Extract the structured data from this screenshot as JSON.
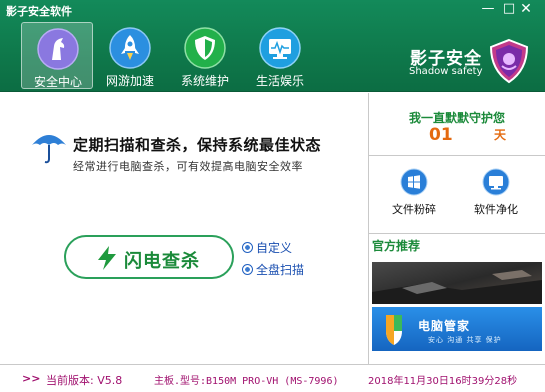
{
  "window": {
    "title": "影子安全软件",
    "min_glyph": "—",
    "max_glyph": "□",
    "close_glyph": "✕"
  },
  "nav": {
    "tabs": [
      {
        "label": "安全中心",
        "icon": "shield-horse-icon",
        "active": true
      },
      {
        "label": "网游加速",
        "icon": "rocket-icon",
        "active": false
      },
      {
        "label": "系统维护",
        "icon": "shield-icon",
        "active": false
      },
      {
        "label": "生活娱乐",
        "icon": "monitor-icon",
        "active": false
      }
    ]
  },
  "brand": {
    "name": "影子安全",
    "name_en": "Shadow safety",
    "logo": "shadow-shield-logo"
  },
  "main": {
    "headline": "定期扫描和查杀，保持系统最佳状态",
    "subline": "经常进行电脑查杀，可有效提高电脑安全效率",
    "scan_button": "闪电查杀",
    "option_custom": "自定义",
    "option_full": "全盘扫描"
  },
  "guard": {
    "title": "我一直默默守护您",
    "days": "01",
    "unit": "天"
  },
  "tools": {
    "shred": "文件粉碎",
    "clean": "软件净化"
  },
  "recommend": {
    "title": "官方推荐",
    "banner2_title": "电脑管家",
    "banner2_sub": "安心 沟通 共享 保护"
  },
  "status": {
    "arrows": ">>",
    "version": "当前版本: V5.8",
    "board": "主板.型号:B150M PRO-VH (MS-7996)",
    "time": "2018年11月30日16时39分28秒"
  },
  "colors": {
    "header_green": "#0f7a4c",
    "accent_green": "#1b8a3a",
    "orange": "#e46a10",
    "status_text": "#a0106e"
  }
}
